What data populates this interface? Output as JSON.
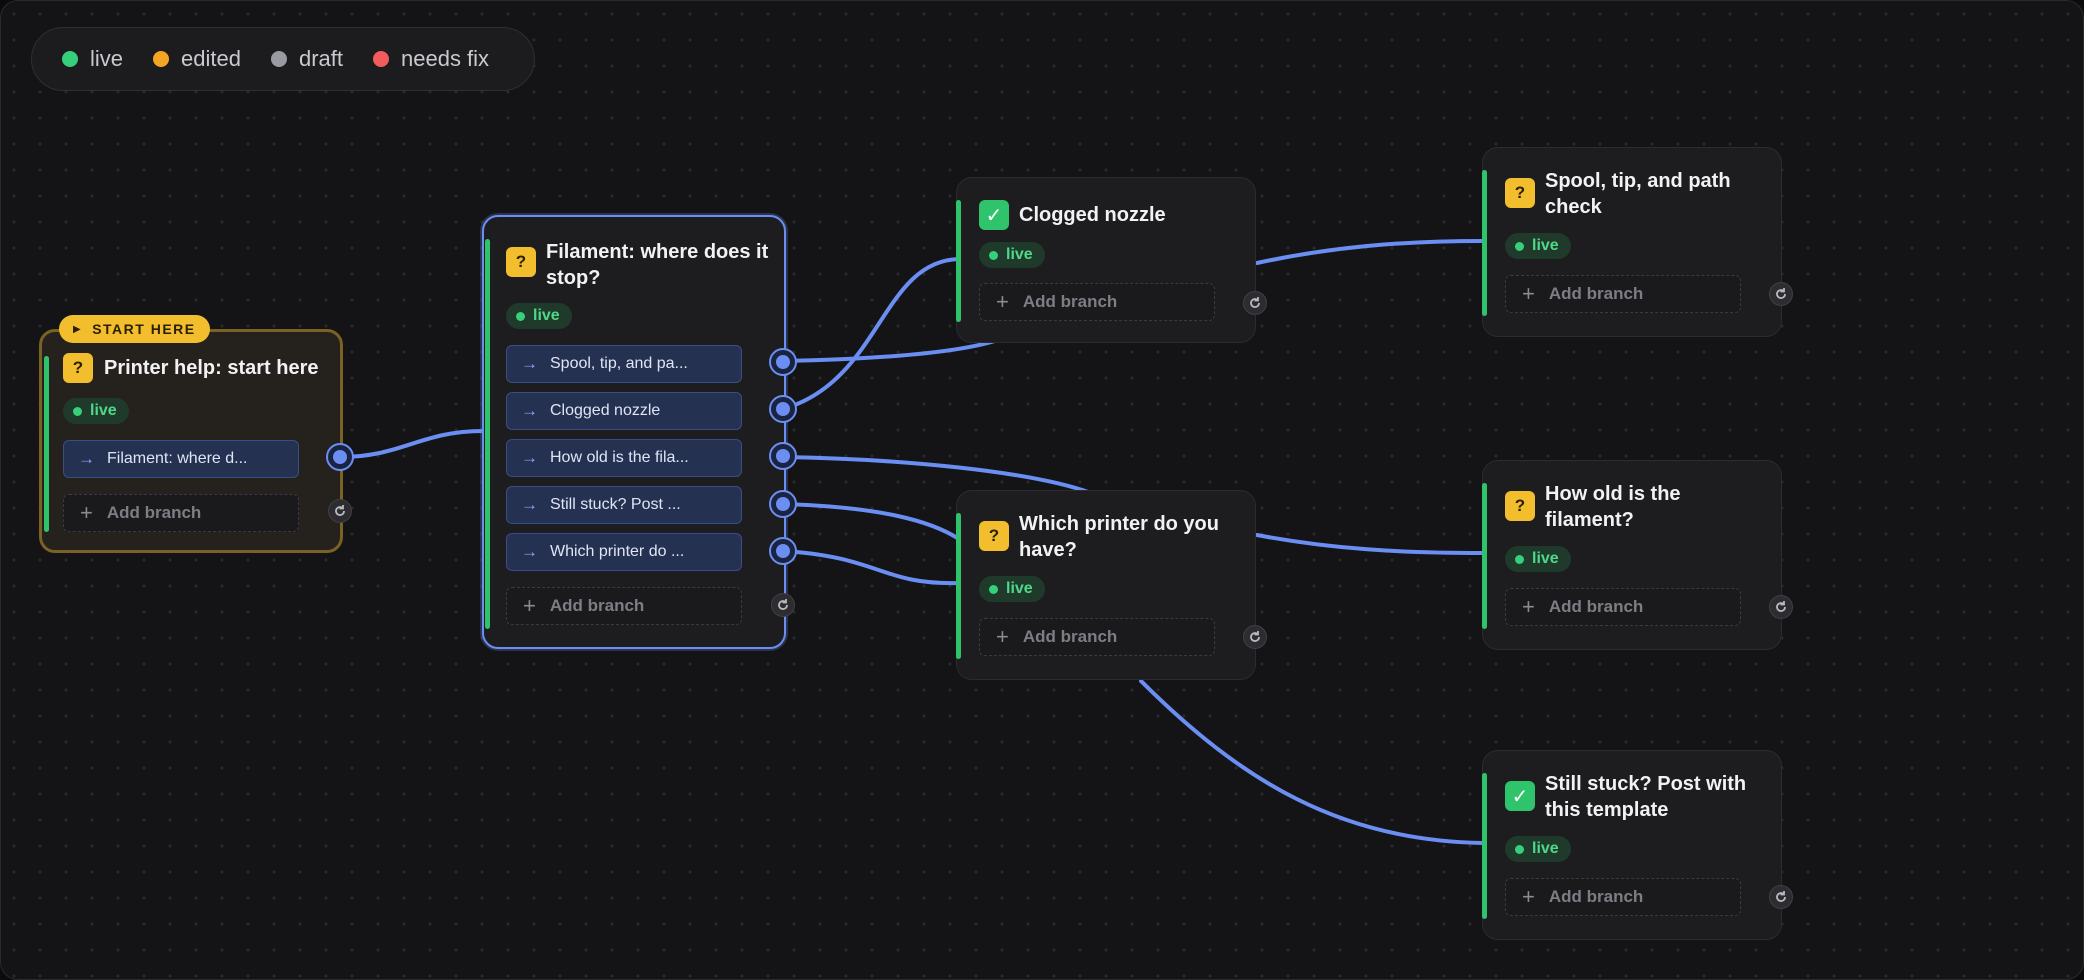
{
  "legend": [
    {
      "label": "live",
      "color": "#36d07b"
    },
    {
      "label": "edited",
      "color": "#f5a524"
    },
    {
      "label": "draft",
      "color": "#9a9aa3"
    },
    {
      "label": "needs fix",
      "color": "#f25c5c"
    }
  ],
  "status_live": "live",
  "add_branch_label": "Add branch",
  "start_badge": "START HERE",
  "nodes": {
    "start": {
      "title": "Printer help: start here",
      "icon": "question-icon",
      "branches": [
        "Filament: where d..."
      ]
    },
    "filament": {
      "title_line1": "Filament: where does it",
      "title_line2": "stop?",
      "icon": "question-icon",
      "branches": [
        "Spool, tip, and pa...",
        "Clogged nozzle",
        "How old is the fila...",
        "Still stuck? Post ...",
        "Which printer do ..."
      ]
    },
    "clogged": {
      "title": "Clogged nozzle",
      "icon": "check-icon"
    },
    "which_printer": {
      "title_line1": "Which printer do you",
      "title_line2": "have?",
      "icon": "question-icon"
    },
    "spool": {
      "title_line1": "Spool, tip, and path",
      "title_line2": "check",
      "icon": "question-icon"
    },
    "how_old": {
      "title_line1": "How old is the",
      "title_line2": "filament?",
      "icon": "question-icon"
    },
    "still_stuck": {
      "title_line1": "Still stuck? Post with",
      "title_line2": "this template",
      "icon": "check-icon"
    }
  }
}
